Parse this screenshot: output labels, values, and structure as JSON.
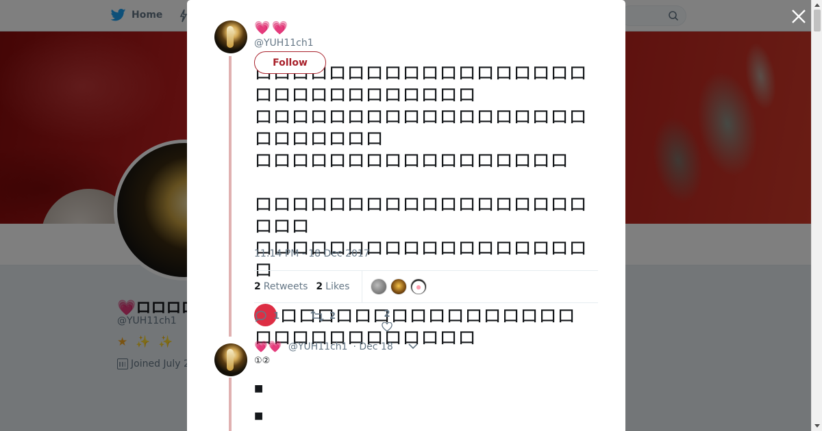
{
  "nav": {
    "home_label": "Home"
  },
  "profile": {
    "name": "💗ロロロロロロ",
    "handle": "@YUH11ch1",
    "stars": [
      "★",
      "✨",
      "✨"
    ],
    "joined": "Joined July 2"
  },
  "tweet": {
    "hearts": "💗💗",
    "handle": "@YUH11ch1",
    "follow_label": "Follow",
    "body_line1": "ロロロロロロロロロロロロロロロロロロロロロロロロロロロロロロ",
    "body_line2": "ロロロロロロロロロロロロロロロロロロロロロロロロロ",
    "body_line3": "ロロロロロロロロロロロロロロロロロ",
    "body_line4": "ロロロロロロロロロロロロロロロロロロロロロ",
    "body_line5": "ロロロロロロロロロロロロロロロロロロロ",
    "body_line6": "ロロロロロロロロロロロロロロロロロロロロロロロロロロロロ",
    "timestamp": "11:14 PM - 18 Dec 2017",
    "retweets_count": "2",
    "retweets_label": "Retweets",
    "likes_count": "2",
    "likes_label": "Likes",
    "reply_count": "1",
    "retweet_count": "2",
    "like_count": "2"
  },
  "reply": {
    "hearts": "💗💗",
    "handle": "@YUH11ch1",
    "date": "· Dec 18",
    "numbers": "①②",
    "block1": "■",
    "block2": "■"
  },
  "colors": {
    "twitter_blue": "#1da1f2",
    "follow_red": "#a8202a",
    "thread_line": "#e0b1b1",
    "red_dot": "#dd2e44"
  }
}
